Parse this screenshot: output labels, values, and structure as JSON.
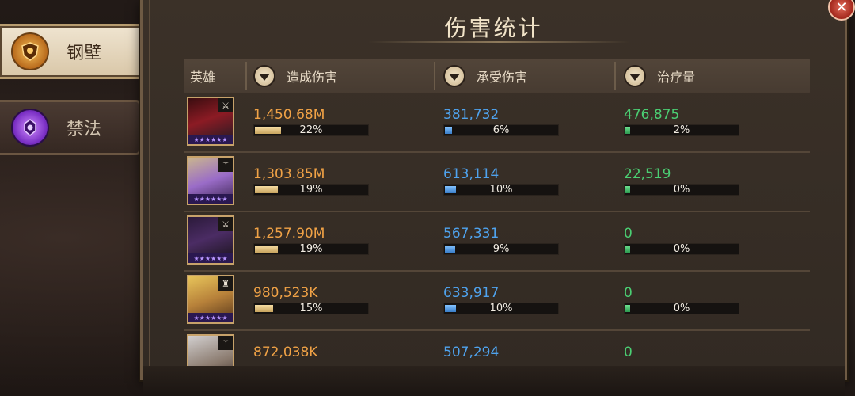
{
  "tabs": [
    {
      "label": "钢壁",
      "icon": "shield-crest-icon",
      "active": true
    },
    {
      "label": "禁法",
      "icon": "arcane-crest-icon",
      "active": false
    }
  ],
  "panel": {
    "title": "伤害统计",
    "close_icon": "close-icon",
    "columns": {
      "hero": "英雄",
      "damage": "造成伤害",
      "taken": "承受伤害",
      "heal": "治疗量"
    }
  },
  "colors": {
    "damage": "#f0a246",
    "taken": "#4fa3ee",
    "heal": "#4bcf73",
    "panel_bg": "#3b3128"
  },
  "rows": [
    {
      "class_icon": "sword-icon",
      "stars": "★★★★★★",
      "damage": "1,450.68M",
      "damage_pct": "22%",
      "damage_ratio": 0.22,
      "taken": "381,732",
      "taken_pct": "6%",
      "taken_ratio": 0.06,
      "heal": "476,875",
      "heal_pct": "2%",
      "heal_ratio": 0.02
    },
    {
      "class_icon": "wand-icon",
      "stars": "★★★★★★",
      "damage": "1,303.85M",
      "damage_pct": "19%",
      "damage_ratio": 0.19,
      "taken": "613,114",
      "taken_pct": "10%",
      "taken_ratio": 0.1,
      "heal": "22,519",
      "heal_pct": "0%",
      "heal_ratio": 0.0
    },
    {
      "class_icon": "sword-icon",
      "stars": "★★★★★★",
      "damage": "1,257.90M",
      "damage_pct": "19%",
      "damage_ratio": 0.19,
      "taken": "567,331",
      "taken_pct": "9%",
      "taken_ratio": 0.09,
      "heal": "0",
      "heal_pct": "0%",
      "heal_ratio": 0.0
    },
    {
      "class_icon": "rook-icon",
      "stars": "★★★★★★",
      "damage": "980,523K",
      "damage_pct": "15%",
      "damage_ratio": 0.15,
      "taken": "633,917",
      "taken_pct": "10%",
      "taken_ratio": 0.1,
      "heal": "0",
      "heal_pct": "0%",
      "heal_ratio": 0.0
    },
    {
      "class_icon": "wand-icon",
      "stars": "",
      "damage": "872,038K",
      "damage_pct": "",
      "damage_ratio": null,
      "taken": "507,294",
      "taken_pct": "",
      "taken_ratio": null,
      "heal": "0",
      "heal_pct": "",
      "heal_ratio": null
    }
  ]
}
